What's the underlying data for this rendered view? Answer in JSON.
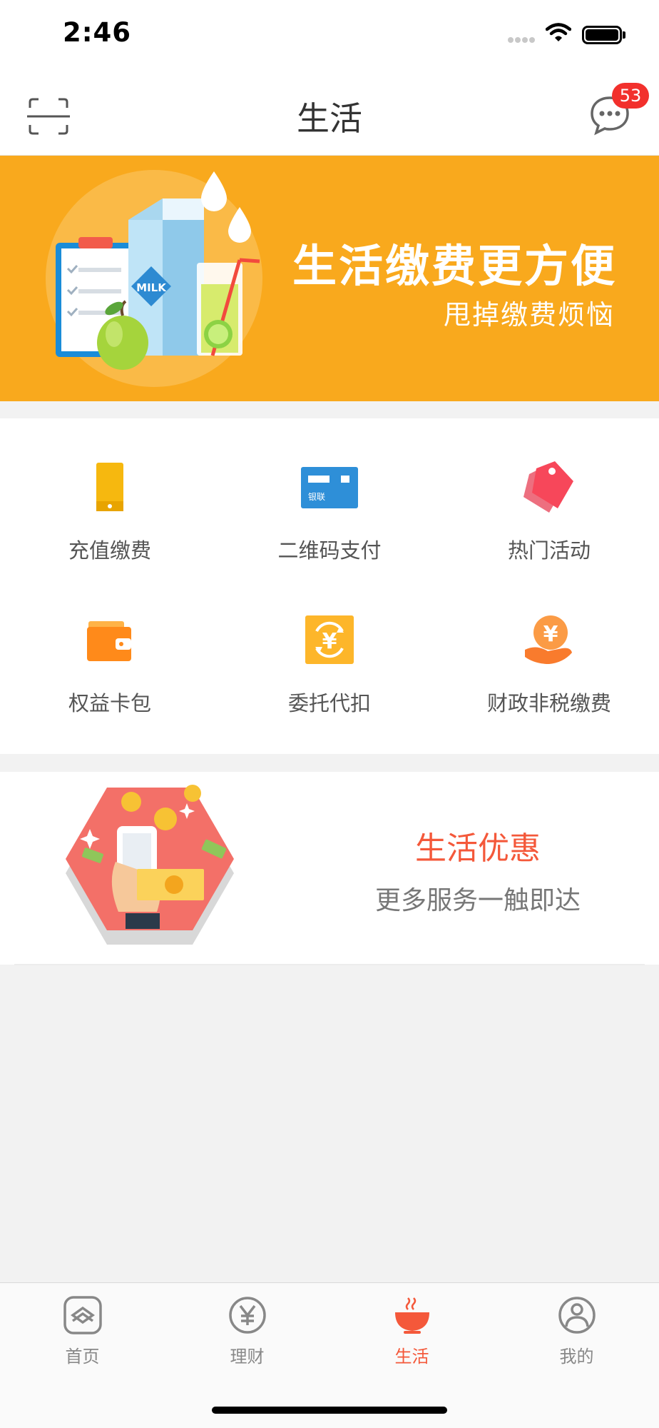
{
  "status": {
    "time": "2:46"
  },
  "header": {
    "title": "生活",
    "message_badge": "53"
  },
  "banner": {
    "title": "生活缴费更方便",
    "subtitle": "甩掉缴费烦恼",
    "milk_label": "MILK",
    "background": "#f9a91d"
  },
  "services": [
    {
      "label": "充值缴费",
      "icon": "phone-icon"
    },
    {
      "label": "二维码支付",
      "icon": "unionpay-card-icon",
      "card_text": "银联"
    },
    {
      "label": "热门活动",
      "icon": "tag-icon"
    },
    {
      "label": "权益卡包",
      "icon": "wallet-icon"
    },
    {
      "label": "委托代扣",
      "icon": "yuan-cycle-icon",
      "glyph": "¥"
    },
    {
      "label": "财政非税缴费",
      "icon": "hand-coin-icon",
      "glyph": "¥"
    }
  ],
  "promo": {
    "title": "生活优惠",
    "subtitle": "更多服务一触即达"
  },
  "tabbar": {
    "tabs": [
      {
        "label": "首页",
        "icon": "home-icon",
        "active": false
      },
      {
        "label": "理财",
        "icon": "yuan-circle-icon",
        "active": false
      },
      {
        "label": "生活",
        "icon": "bowl-icon",
        "active": true
      },
      {
        "label": "我的",
        "icon": "person-icon",
        "active": false
      }
    ],
    "active_color": "#f4583a"
  }
}
